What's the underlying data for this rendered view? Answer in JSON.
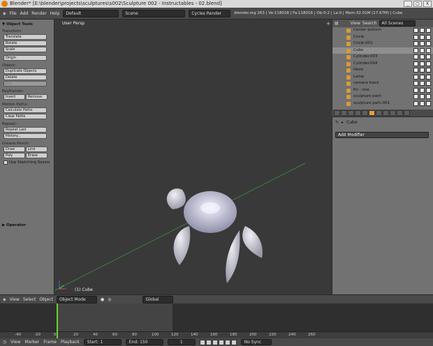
{
  "window": {
    "title": "Blender* [E:\\blender\\projects\\sculptures\\s002\\Sculpture 002 - Instructables - 02.blend]",
    "buttons": [
      "_",
      "□",
      "X"
    ]
  },
  "topbar": {
    "menus": [
      "File",
      "Add",
      "Render",
      "Help"
    ],
    "layout": "Default",
    "scene": "Scene",
    "engine": "Cycles Render",
    "info": "blender.org 263 | Ve:118028 | Fa:118016 | Ob:0-2 | La:0 | Mem:32.01M (17.67M) | Cube"
  },
  "tool_shelf": {
    "title": "Object Tools",
    "transform_label": "Transform:",
    "translate": "Translate",
    "rotate": "Rotate",
    "scale": "Scale",
    "origin": "Origin",
    "object_label": "Object:",
    "duplicate": "Duplicate Objects",
    "delete": "Delete",
    "join": "Join",
    "keyframes_label": "Keyframes:",
    "insert": "Insert",
    "remove": "Remove",
    "motion_label": "Motion Paths:",
    "calc_path": "Calculate Paths",
    "clear_path": "Clear Paths",
    "repeat_label": "Repeat:",
    "repeat_last": "Repeat Last",
    "history": "History...",
    "grease_label": "Grease Pencil:",
    "draw": "Draw",
    "line": "Line",
    "poly": "Poly",
    "erase": "Erase",
    "sketching": "Use Sketching Sessio",
    "operator": "Operator"
  },
  "viewport": {
    "label": "User Persp",
    "object": "(1) Cube",
    "plus": "+"
  },
  "outliner": {
    "view": "View",
    "search": "Search",
    "scenes": "All Scenes",
    "items": [
      {
        "name": "Center bottom",
        "selected": false
      },
      {
        "name": "Circle",
        "selected": false
      },
      {
        "name": "Circle.001",
        "selected": false
      },
      {
        "name": "Cube",
        "selected": true
      },
      {
        "name": "Cylinder.003",
        "selected": false
      },
      {
        "name": "Cylinder.004",
        "selected": false
      },
      {
        "name": "Hemi",
        "selected": false
      },
      {
        "name": "Lamp",
        "selected": false
      },
      {
        "name": "camera track",
        "selected": false
      },
      {
        "name": "fin - one",
        "selected": false
      },
      {
        "name": "sculpture path",
        "selected": false
      },
      {
        "name": "sculpture path.001",
        "selected": false
      }
    ]
  },
  "properties": {
    "object": "Cube",
    "add_modifier": "Add Modifier"
  },
  "view3d_header": {
    "view": "View",
    "select": "Select",
    "object": "Object",
    "mode": "Object Mode",
    "orientation": "Global"
  },
  "timeline": {
    "ticks": [
      "-40",
      "-20",
      "0",
      "20",
      "40",
      "60",
      "80",
      "100",
      "120",
      "140",
      "160",
      "180",
      "200",
      "220",
      "240",
      "260"
    ],
    "current_frame": 1,
    "view": "View",
    "marker": "Marker",
    "frame": "Frame",
    "playback": "Playback",
    "start": "Start: 1",
    "end": "End: 150",
    "frame_value": "1",
    "sync": "No Sync"
  }
}
